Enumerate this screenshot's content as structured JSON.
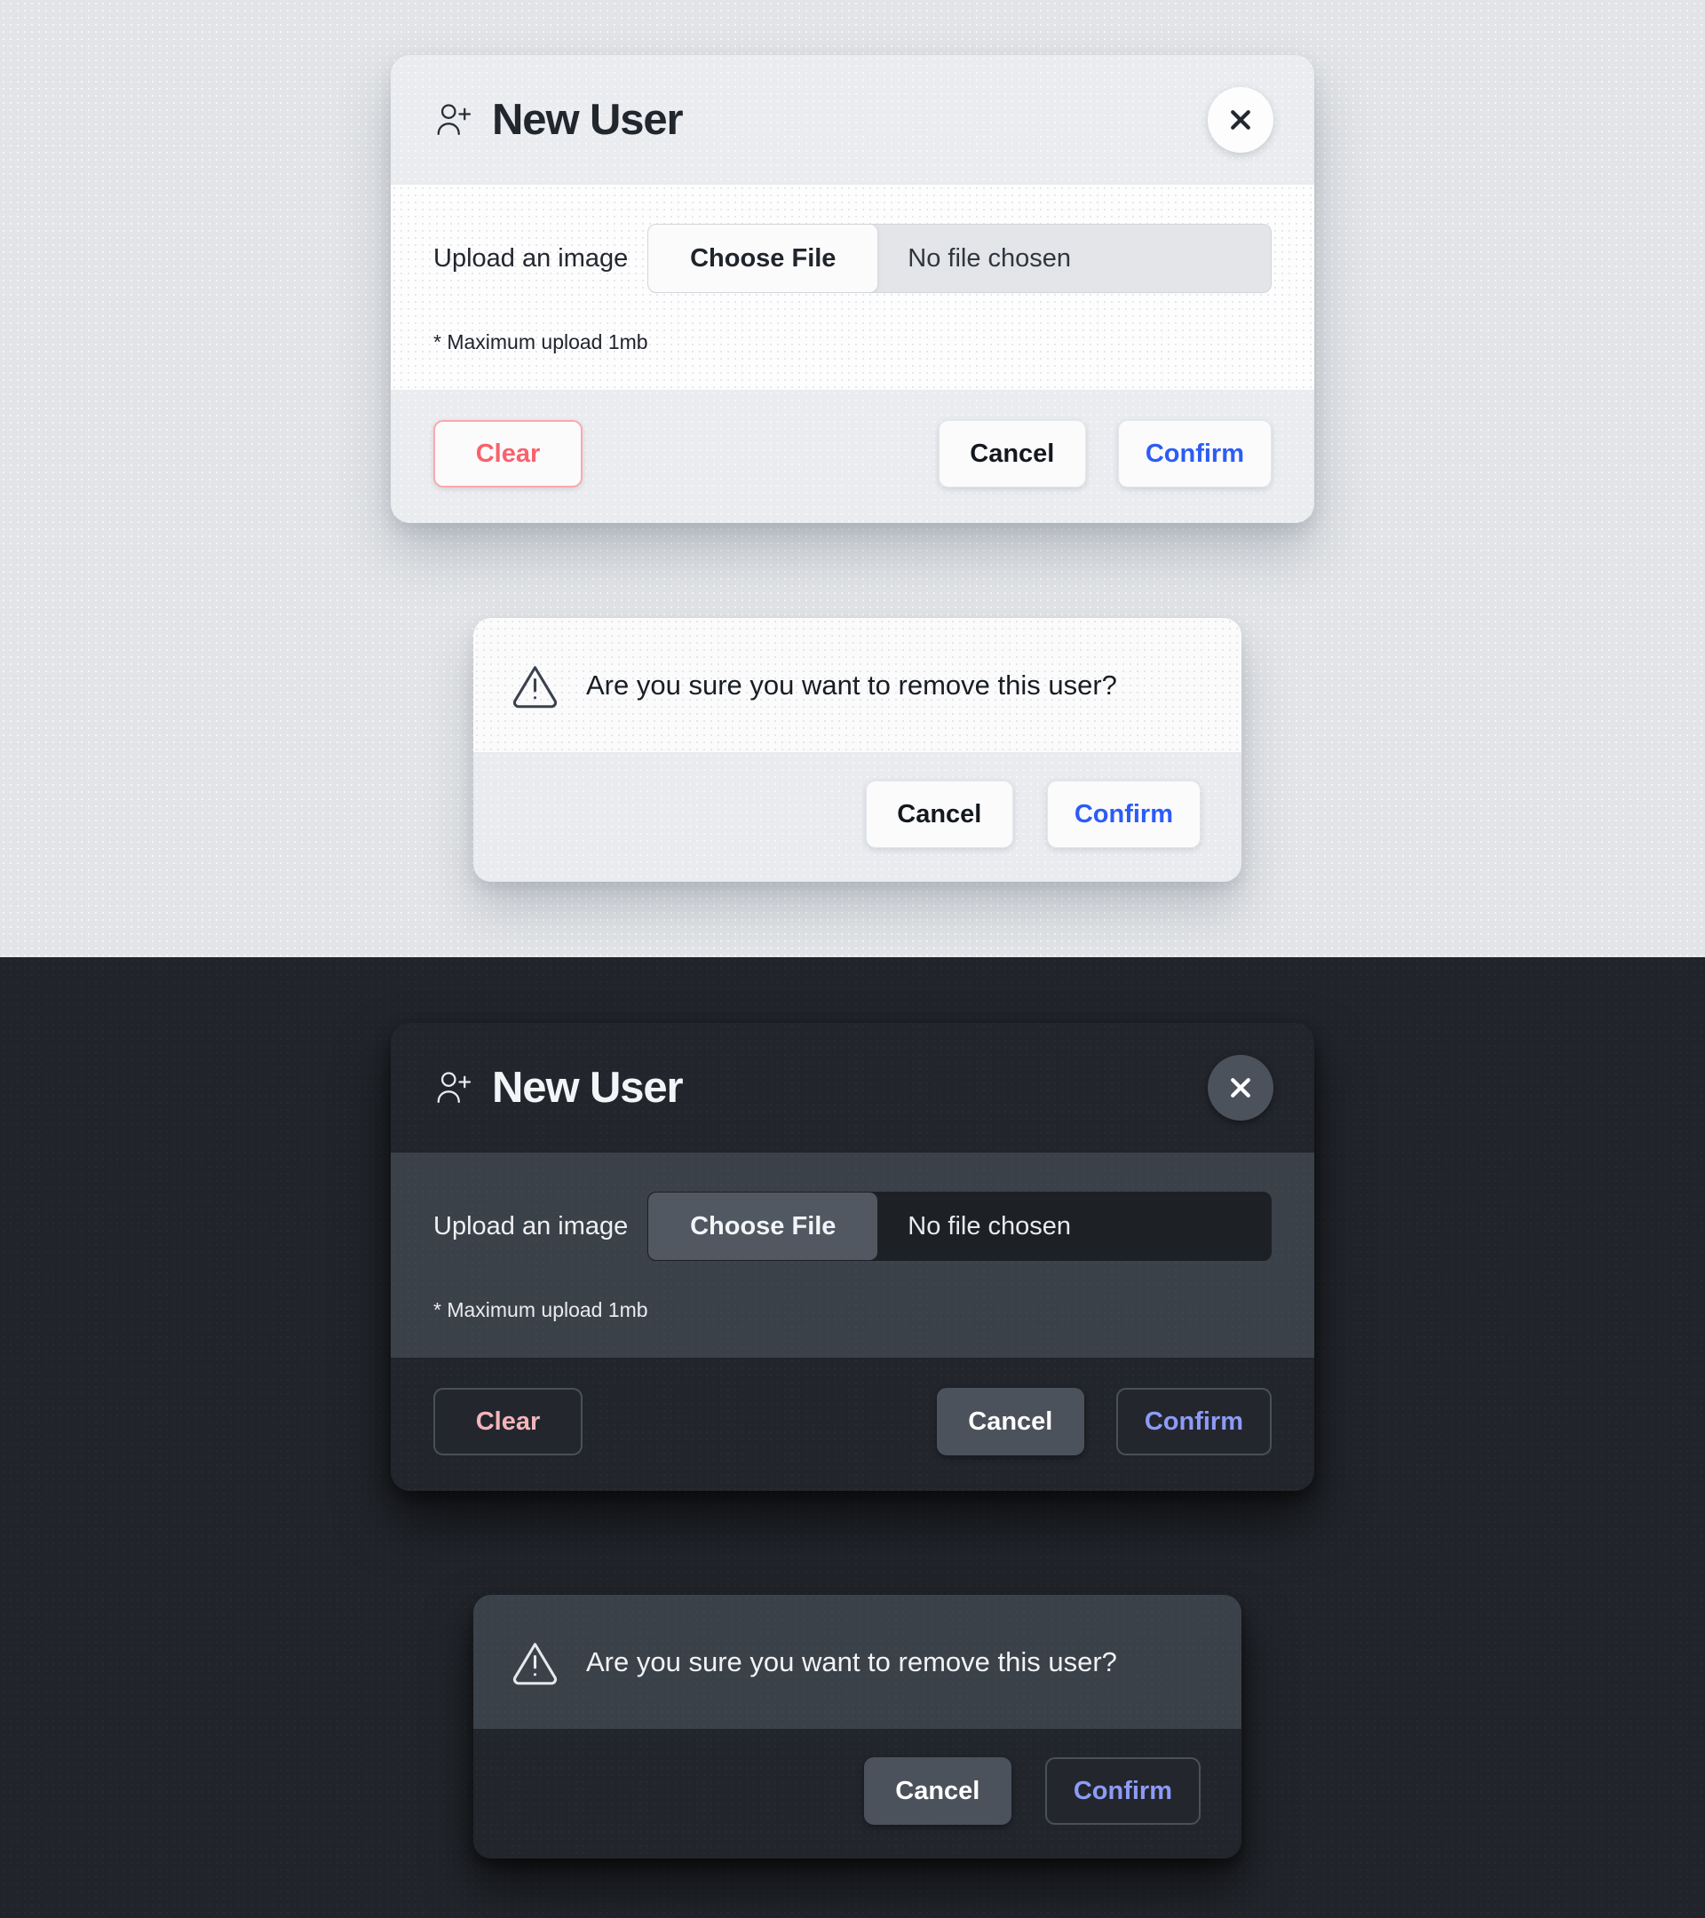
{
  "theme_sections": {
    "light": {
      "background_color": "#e2e4e7"
    },
    "dark": {
      "background_color": "#21242a"
    }
  },
  "new_user_modal": {
    "icon": "user-add-icon",
    "title": "New User",
    "close_icon": "close-icon",
    "upload": {
      "label": "Upload an image",
      "choose_file_label": "Choose File",
      "file_status": "No file chosen",
      "note": "* Maximum upload 1mb"
    },
    "footer": {
      "clear_label": "Clear",
      "cancel_label": "Cancel",
      "confirm_label": "Confirm"
    }
  },
  "remove_user_dialog": {
    "icon": "warning-triangle-icon",
    "message": "Are you sure you want to remove this user?",
    "footer": {
      "cancel_label": "Cancel",
      "confirm_label": "Confirm"
    }
  },
  "colors": {
    "accent_blue_light": "#2c5cf6",
    "accent_blue_dark": "#8d9bf7",
    "danger_light": "#f9626b",
    "danger_dark": "#f4b5bb"
  }
}
